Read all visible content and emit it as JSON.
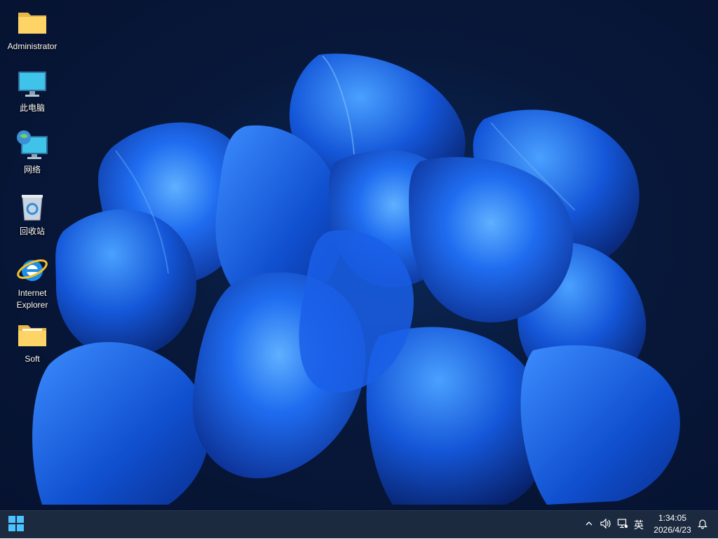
{
  "desktop": {
    "icons": [
      {
        "label": "Administrator",
        "icon": "folder-icon"
      },
      {
        "label": "此电脑",
        "icon": "computer-icon"
      },
      {
        "label": "网络",
        "icon": "network-icon"
      },
      {
        "label": "回收站",
        "icon": "recycle-bin-icon"
      },
      {
        "label": "Internet Explorer",
        "icon": "internet-explorer-icon"
      },
      {
        "label": "Soft",
        "icon": "folder-icon"
      }
    ]
  },
  "taskbar": {
    "start_icon": "windows-logo-icon",
    "tray": {
      "show_hidden_icon": "chevron-up-icon",
      "volume_icon": "speaker-icon",
      "network_icon": "network-status-icon",
      "ime_label": "英",
      "notification_icon": "bell-icon"
    },
    "clock": {
      "time": "1:34:05",
      "date": "2026/4/23"
    }
  },
  "colors": {
    "wallpaper_bg": "#061230",
    "petal_blue": "#1a6dff",
    "taskbar_bg": "#1c2a3f",
    "text": "#ffffff"
  }
}
